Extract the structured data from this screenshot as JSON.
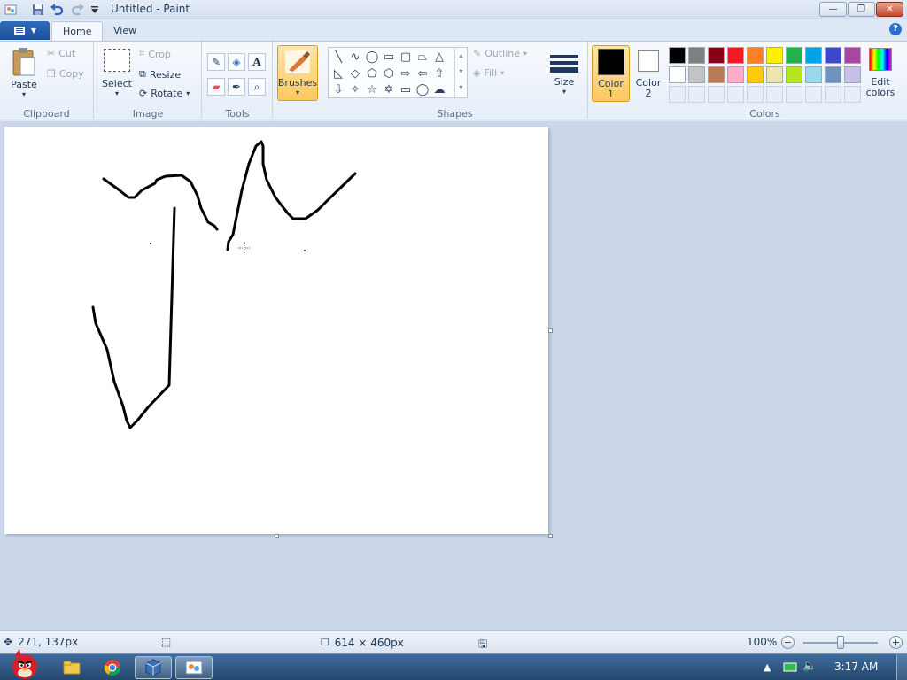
{
  "window": {
    "title": "Untitled - Paint",
    "controls": {
      "minimize": "—",
      "maximize": "❐",
      "close": "✕"
    }
  },
  "ribbon": {
    "file_menu_label": "▼",
    "tabs": [
      {
        "label": "Home",
        "active": true
      },
      {
        "label": "View",
        "active": false
      }
    ],
    "help": "?",
    "clipboard": {
      "group_label": "Clipboard",
      "paste": "Paste",
      "cut": "Cut",
      "copy": "Copy"
    },
    "image": {
      "group_label": "Image",
      "select": "Select",
      "crop": "Crop",
      "resize": "Resize",
      "rotate": "Rotate"
    },
    "tools": {
      "group_label": "Tools"
    },
    "brushes": {
      "label": "Brushes"
    },
    "shapes": {
      "group_label": "Shapes",
      "outline": "Outline",
      "fill": "Fill"
    },
    "size": {
      "label": "Size"
    },
    "color1": {
      "label_line1": "Color",
      "label_line2": "1",
      "value": "#000000"
    },
    "color2": {
      "label_line1": "Color",
      "label_line2": "2",
      "value": "#ffffff"
    },
    "colors": {
      "group_label": "Colors",
      "edit_line1": "Edit",
      "edit_line2": "colors",
      "palette_row1": [
        "#000000",
        "#7f7f7f",
        "#880015",
        "#ed1c24",
        "#ff7f27",
        "#fff200",
        "#22b14c",
        "#00a2e8",
        "#3f48cc",
        "#a349a4"
      ],
      "palette_row2": [
        "#ffffff",
        "#c3c3c3",
        "#b97a57",
        "#ffaec9",
        "#ffc90e",
        "#efe4b0",
        "#b5e61d",
        "#99d9ea",
        "#7092be",
        "#c8bfe7"
      ]
    }
  },
  "statusbar": {
    "cursor_pos": "271, 137px",
    "canvas_size": "614 × 460px",
    "zoom": "100%",
    "zoom_level_fraction": 0.5
  },
  "taskbar": {
    "clock": "3:17 AM"
  }
}
